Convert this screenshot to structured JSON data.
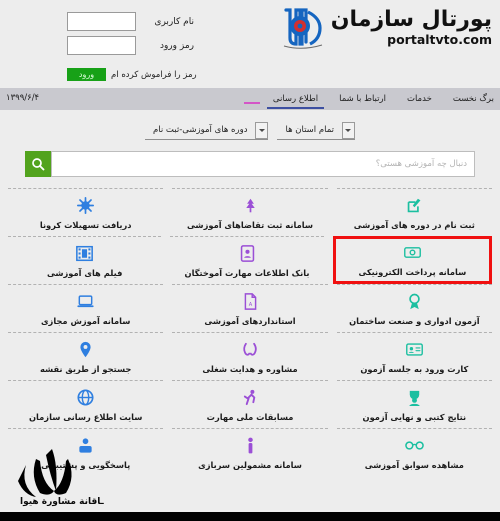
{
  "header": {
    "logo_title": "پورتال سازمان",
    "logo_subtitle": "portaltvto.com",
    "emblem_name": "tvto-organization-emblem",
    "emblem_blue": "#1565c0",
    "emblem_red": "#d32f2f"
  },
  "login": {
    "username_label": "نام کاربری",
    "password_label": "رمز ورود",
    "username_value": "",
    "password_value": "",
    "submit_label": "ورود",
    "forgot_label": "رمز را فراموش کرده ام",
    "submit_color": "#17a117"
  },
  "nav": {
    "items": [
      {
        "label": "برگ نخست",
        "underline": "none"
      },
      {
        "label": "خدمات",
        "underline": "none"
      },
      {
        "label": "ارتباط با شما",
        "underline": "none"
      },
      {
        "label": "اطلاع رسانی",
        "underline": "blue"
      },
      {
        "label": "",
        "underline": "pink"
      }
    ],
    "date": "۱۳۹۹/۶/۴",
    "underline_blue": "#3d4fa1",
    "underline_pink": "#d455c7"
  },
  "filters": {
    "course_type": "دوره های آموزشی-ثبت نام",
    "province": "تمام استان ها"
  },
  "search": {
    "placeholder": "دنبال چه آموزشی هستی؟",
    "value": "",
    "button_icon": "search-icon",
    "button_color": "#52a31d"
  },
  "tiles": [
    [
      {
        "label": "ثبت نام در دوره های آموزشی",
        "icon": "edit-square-icon",
        "color": "#1bbfa0",
        "highlight": false
      },
      {
        "label": "سامانه ثبت تقاضاهای آموزشی",
        "icon": "tree-icon",
        "color": "#9b4fd6",
        "highlight": false
      },
      {
        "label": "دریافت تسهیلات کرونا",
        "icon": "virus-icon",
        "color": "#2f7fe0",
        "highlight": false
      }
    ],
    [
      {
        "label": "سامانه پرداخت الکترونیکی",
        "icon": "banknote-icon",
        "color": "#1bbfa0",
        "highlight": true
      },
      {
        "label": "بانک اطلاعات مهارت آموختگان",
        "icon": "id-badge-icon",
        "color": "#9b4fd6",
        "highlight": false
      },
      {
        "label": "فیلم های آموزشی",
        "icon": "film-icon",
        "color": "#2f7fe0",
        "highlight": false
      }
    ],
    [
      {
        "label": "آزمون ادواری و صنعت ساختمان",
        "icon": "medal-icon",
        "color": "#1bbfa0",
        "highlight": false
      },
      {
        "label": "استانداردهای آموزشی",
        "icon": "pdf-file-icon",
        "color": "#9b4fd6",
        "highlight": false
      },
      {
        "label": "سامانه آموزش مجازی",
        "icon": "laptop-icon",
        "color": "#2f7fe0",
        "highlight": false
      }
    ],
    [
      {
        "label": "کارت ورود به جلسه آزمون",
        "icon": "id-card-icon",
        "color": "#1bbfa0",
        "highlight": false
      },
      {
        "label": "مشاوره و هدایت شغلی",
        "icon": "helping-hands-icon",
        "color": "#9b4fd6",
        "highlight": false
      },
      {
        "label": "جستجو از طریق نقشه",
        "icon": "map-pin-icon",
        "color": "#2f7fe0",
        "highlight": false
      }
    ],
    [
      {
        "label": "نتایج کتبی و نهایی آزمون",
        "icon": "person-result-icon",
        "color": "#1bbfa0",
        "highlight": false
      },
      {
        "label": "مسابقات ملی مهارت",
        "icon": "athlete-icon",
        "color": "#9b4fd6",
        "highlight": false
      },
      {
        "label": "سایت اطلاع رسانی سازمان",
        "icon": "globe-icon",
        "color": "#2f7fe0",
        "highlight": false
      }
    ],
    [
      {
        "label": "مشاهده سوابق آموزشی",
        "icon": "glasses-icon",
        "color": "#1bbfa0",
        "highlight": false
      },
      {
        "label": "سامانه مشمولین سربازی",
        "icon": "soldier-icon",
        "color": "#9b4fd6",
        "highlight": false
      },
      {
        "label": "پاسخگویی و پشتیبانی",
        "icon": "support-agent-icon",
        "color": "#2f7fe0",
        "highlight": false
      }
    ]
  ],
  "watermark": {
    "text": "ـاقانة مشاورة هیوا",
    "logo_name": "tulip-watermark-logo"
  },
  "highlight_color": "#f01010"
}
